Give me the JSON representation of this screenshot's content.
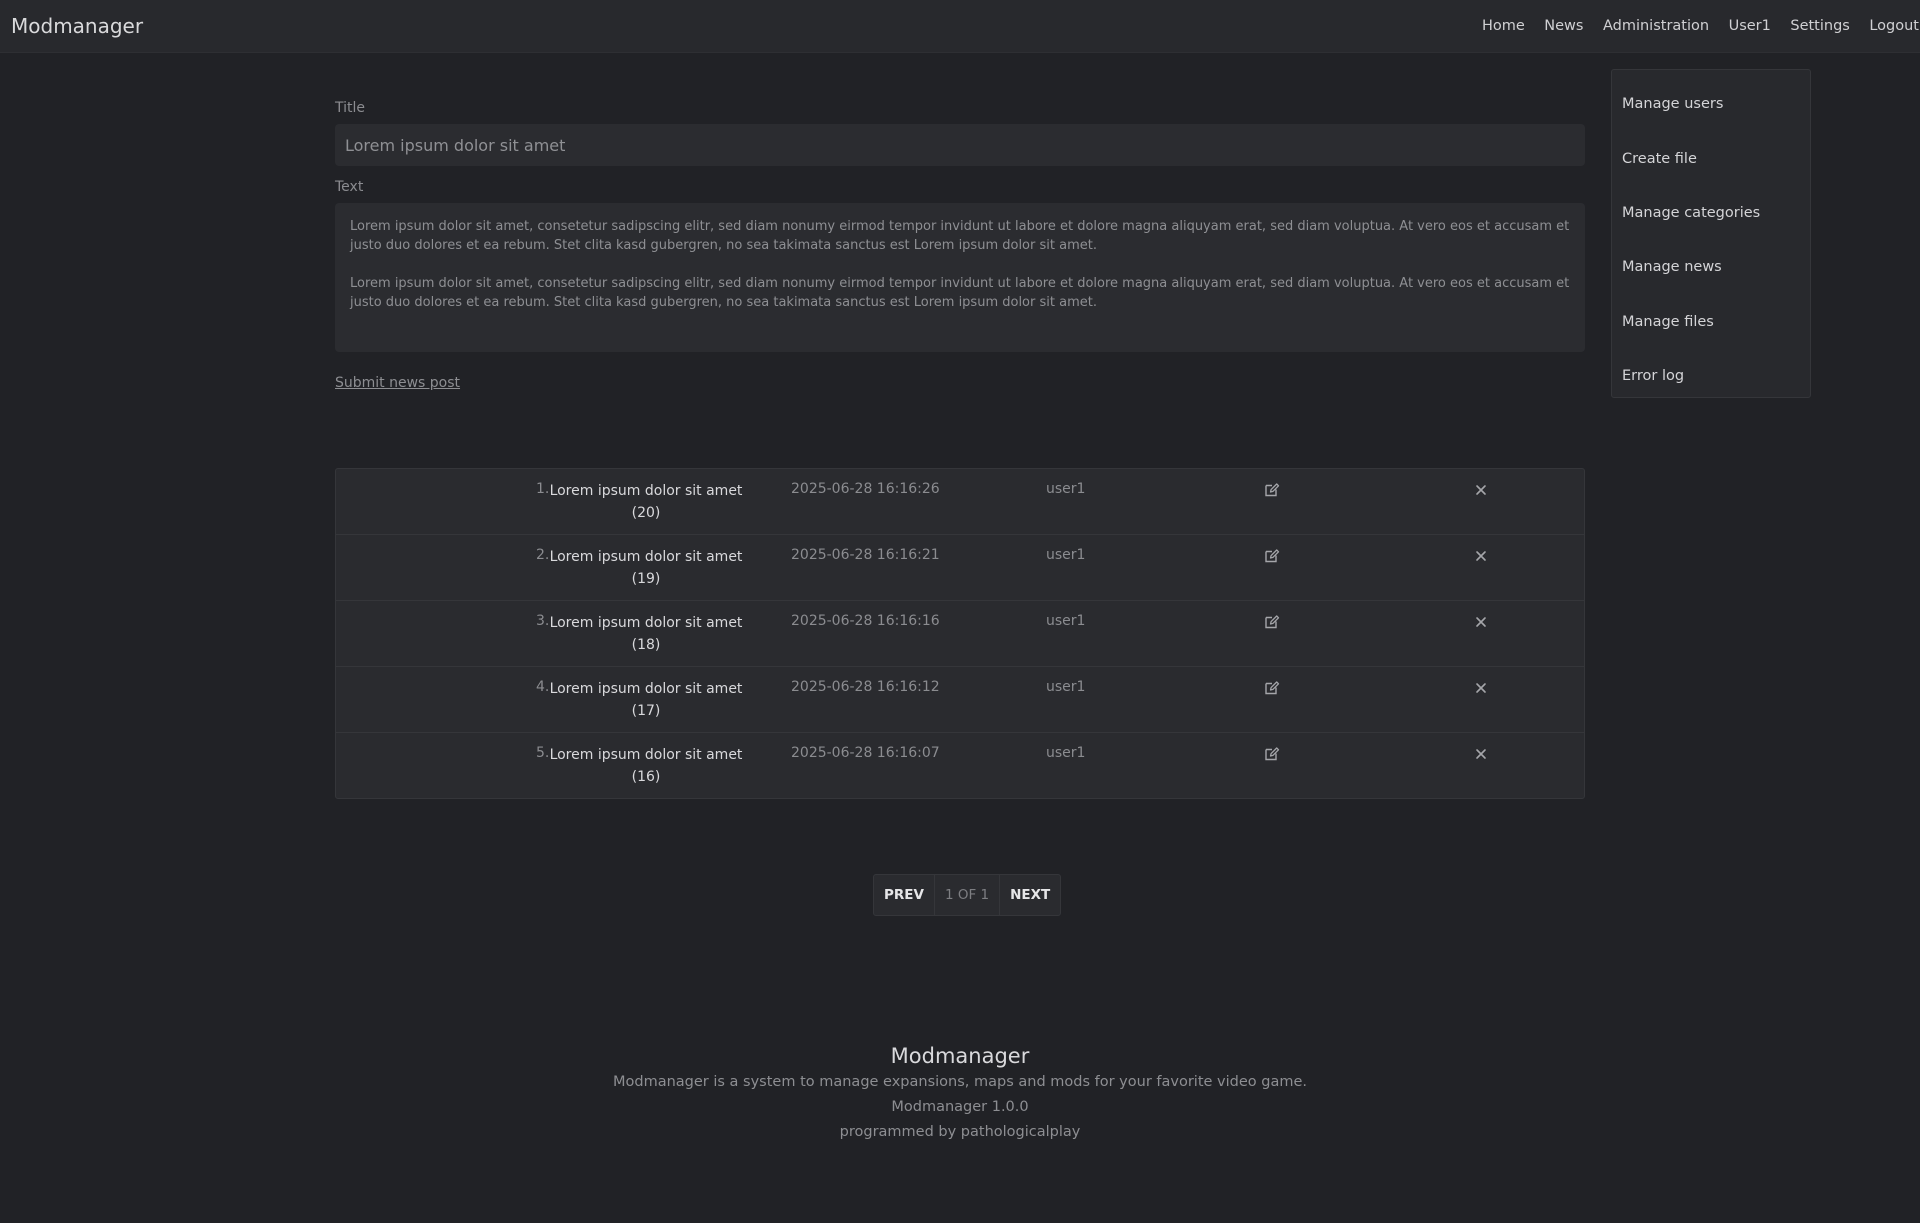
{
  "app": {
    "brand": "Modmanager"
  },
  "nav": {
    "home": "Home",
    "news": "News",
    "administration": "Administration",
    "user": "User1",
    "settings": "Settings",
    "logout": "Logout"
  },
  "form": {
    "title_label": "Title",
    "title_placeholder": "Lorem ipsum dolor sit amet",
    "text_label": "Text",
    "text_paragraphs": [
      "Lorem ipsum dolor sit amet, consetetur sadipscing elitr, sed diam nonumy eirmod tempor invidunt ut labore et dolore magna aliquyam erat, sed diam voluptua. At vero eos et accusam et justo duo dolores et ea rebum. Stet clita kasd gubergren, no sea takimata sanctus est Lorem ipsum dolor sit amet.",
      "Lorem ipsum dolor sit amet, consetetur sadipscing elitr, sed diam nonumy eirmod tempor invidunt ut labore et dolore magna aliquyam erat, sed diam voluptua. At vero eos et accusam et justo duo dolores et ea rebum. Stet clita kasd gubergren, no sea takimata sanctus est Lorem ipsum dolor sit amet."
    ],
    "submit_label": "Submit news post"
  },
  "news_rows": [
    {
      "num": "1.",
      "title": "Lorem ipsum dolor sit amet",
      "count": "(20)",
      "date": "2025-06-28 16:16:26",
      "user": "user1"
    },
    {
      "num": "2.",
      "title": "Lorem ipsum dolor sit amet",
      "count": "(19)",
      "date": "2025-06-28 16:16:21",
      "user": "user1"
    },
    {
      "num": "3.",
      "title": "Lorem ipsum dolor sit amet",
      "count": "(18)",
      "date": "2025-06-28 16:16:16",
      "user": "user1"
    },
    {
      "num": "4.",
      "title": "Lorem ipsum dolor sit amet",
      "count": "(17)",
      "date": "2025-06-28 16:16:12",
      "user": "user1"
    },
    {
      "num": "5.",
      "title": "Lorem ipsum dolor sit amet",
      "count": "(16)",
      "date": "2025-06-28 16:16:07",
      "user": "user1"
    }
  ],
  "row_icons": {
    "edit": "edit-icon",
    "delete": "close-icon"
  },
  "pagination": {
    "prev": "PREV",
    "info": "1 OF 1",
    "next": "NEXT"
  },
  "sidebar": {
    "items": [
      {
        "label": "Manage users"
      },
      {
        "label": "Create file"
      },
      {
        "label": "Manage categories"
      },
      {
        "label": "Manage news"
      },
      {
        "label": "Manage files"
      },
      {
        "label": "Error log"
      }
    ]
  },
  "footer": {
    "title": "Modmanager",
    "description": "Modmanager is a system to manage expansions, maps and mods for your favorite video game.",
    "version": "Modmanager 1.0.0",
    "credit": "programmed by pathologicalplay"
  },
  "colors": {
    "background": "#212226",
    "panel": "#2a2b2f",
    "text": "#d8d8da",
    "muted": "#8b8c90"
  }
}
